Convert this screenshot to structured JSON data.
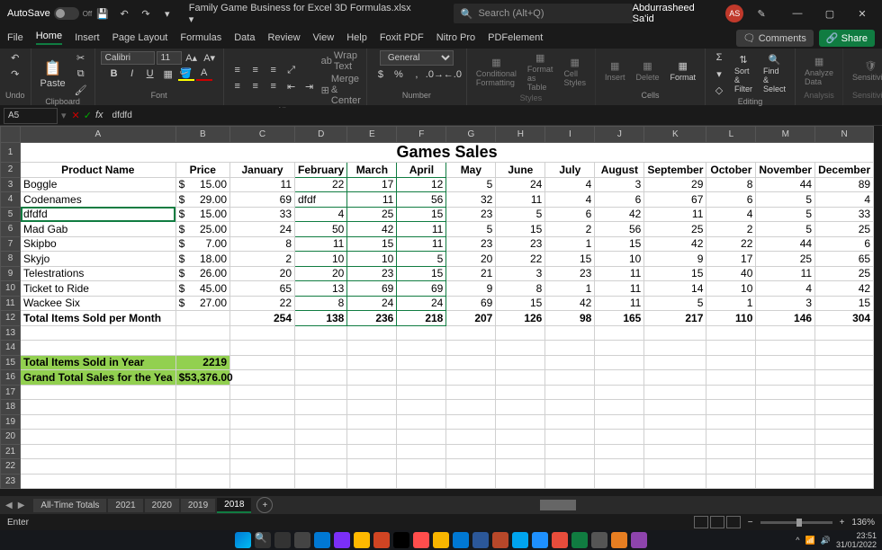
{
  "titlebar": {
    "autosave_label": "AutoSave",
    "autosave_state": "Off",
    "filename": "Family Game Business for Excel 3D Formulas.xlsx ▾",
    "search_placeholder": "Search (Alt+Q)",
    "username": "Abdurrasheed Sa'id",
    "user_initials": "AS"
  },
  "ribbon_tabs": [
    "File",
    "Home",
    "Insert",
    "Page Layout",
    "Formulas",
    "Data",
    "Review",
    "View",
    "Help",
    "Foxit PDF",
    "Nitro Pro",
    "PDFelement"
  ],
  "ribbon_active_tab": "Home",
  "ribbon_right": {
    "comments": "Comments",
    "share": "Share"
  },
  "ribbon": {
    "undo_label": "Undo",
    "clipboard_label": "Clipboard",
    "paste_label": "Paste",
    "font_label": "Font",
    "font_name": "Calibri",
    "font_size": "11",
    "alignment_label": "Alignment",
    "wrap_text": "Wrap Text",
    "merge_center": "Merge & Center",
    "number_label": "Number",
    "number_format": "General",
    "styles_label": "Styles",
    "cond_fmt": "Conditional Formatting",
    "fmt_table": "Format as Table",
    "cell_styles": "Cell Styles",
    "cells_label": "Cells",
    "insert": "Insert",
    "delete": "Delete",
    "format": "Format",
    "editing_label": "Editing",
    "sort_filter": "Sort & Filter",
    "find_select": "Find & Select",
    "analysis_label": "Analysis",
    "analyze_data": "Analyze Data",
    "sensitivity_label": "Sensitivity",
    "sensitivity": "Sensitivity"
  },
  "formula_bar": {
    "name_box": "A5",
    "formula": "dfdfd"
  },
  "columns": [
    "A",
    "B",
    "C",
    "D",
    "E",
    "F",
    "G",
    "H",
    "I",
    "J",
    "K",
    "L",
    "M",
    "N"
  ],
  "sheet": {
    "title": "Games Sales",
    "headers": {
      "product": "Product Name",
      "price": "Price",
      "months": [
        "January",
        "February",
        "March",
        "April",
        "May",
        "June",
        "July",
        "August",
        "September",
        "October",
        "November",
        "December"
      ],
      "year_trail": "Ye"
    },
    "rows": [
      {
        "name": "Boggle",
        "price": "15.00",
        "vals": [
          "11",
          "22",
          "17",
          "12",
          "5",
          "24",
          "4",
          "3",
          "29",
          "8",
          "44",
          "89"
        ]
      },
      {
        "name": "Codenames",
        "price": "29.00",
        "vals": [
          "69",
          "dfdf",
          "11",
          "56",
          "32",
          "11",
          "4",
          "6",
          "67",
          "6",
          "5",
          "4"
        ]
      },
      {
        "name": "dfdfd",
        "price": "15.00",
        "vals": [
          "33",
          "4",
          "25",
          "15",
          "23",
          "5",
          "6",
          "42",
          "11",
          "4",
          "5",
          "33"
        ]
      },
      {
        "name": "Mad Gab",
        "price": "25.00",
        "vals": [
          "24",
          "50",
          "42",
          "11",
          "5",
          "15",
          "2",
          "56",
          "25",
          "2",
          "5",
          "25"
        ]
      },
      {
        "name": "Skipbo",
        "price": "7.00",
        "vals": [
          "8",
          "11",
          "15",
          "11",
          "23",
          "23",
          "1",
          "15",
          "42",
          "22",
          "44",
          "6"
        ]
      },
      {
        "name": "Skyjo",
        "price": "18.00",
        "vals": [
          "2",
          "10",
          "10",
          "5",
          "20",
          "22",
          "15",
          "10",
          "9",
          "17",
          "25",
          "65"
        ]
      },
      {
        "name": "Telestrations",
        "price": "26.00",
        "vals": [
          "20",
          "20",
          "23",
          "15",
          "21",
          "3",
          "23",
          "11",
          "15",
          "40",
          "11",
          "25"
        ]
      },
      {
        "name": "Ticket to Ride",
        "price": "45.00",
        "vals": [
          "65",
          "13",
          "69",
          "69",
          "9",
          "8",
          "1",
          "11",
          "14",
          "10",
          "4",
          "42"
        ]
      },
      {
        "name": "Wackee Six",
        "price": "27.00",
        "vals": [
          "22",
          "8",
          "24",
          "24",
          "69",
          "15",
          "42",
          "11",
          "5",
          "1",
          "3",
          "15"
        ]
      }
    ],
    "totals_row": {
      "label": "Total Items Sold per Month",
      "vals": [
        "254",
        "138",
        "236",
        "218",
        "207",
        "126",
        "98",
        "165",
        "217",
        "110",
        "146",
        "304"
      ]
    },
    "summary_year": {
      "label": "Total Items Sold in Year",
      "value": "2219"
    },
    "summary_total": {
      "label": "Grand Total Sales for the Yea",
      "sym": "$",
      "value": "53,376.00"
    },
    "trailing_sym": "$",
    "cur_sym": "$"
  },
  "sheet_tabs": [
    "All-Time Totals",
    "2021",
    "2020",
    "2019",
    "2018"
  ],
  "sheet_active": "2018",
  "statusbar": {
    "mode": "Enter",
    "zoom": "136%"
  },
  "tray": {
    "time": "23:51",
    "date": "31/01/2022"
  }
}
